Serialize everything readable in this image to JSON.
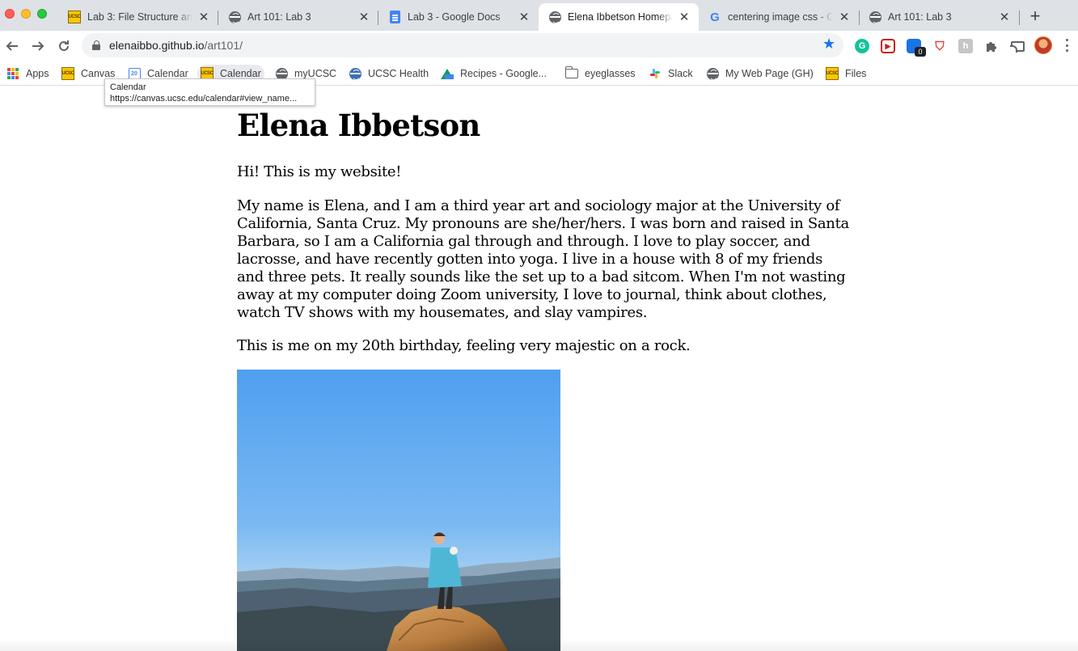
{
  "browser": {
    "tabs": [
      {
        "title": "Lab 3: File Structure and",
        "icon": "ucsc-icon",
        "active": false
      },
      {
        "title": "Art 101: Lab 3",
        "icon": "globe-icon",
        "active": false
      },
      {
        "title": "Lab 3 - Google Docs",
        "icon": "google-docs-icon",
        "active": false
      },
      {
        "title": "Elena Ibbetson Homepage",
        "icon": "globe-icon",
        "active": true
      },
      {
        "title": "centering image css - Goo",
        "icon": "google-icon",
        "active": false
      },
      {
        "title": "Art 101: Lab 3",
        "icon": "globe-icon",
        "active": false
      }
    ],
    "close_glyph": "✕",
    "new_tab_glyph": "+",
    "address": {
      "host": "elenaibbo.github.io",
      "path": "/art101/"
    },
    "extensions": {
      "grammarly": "G",
      "redbox": "▶",
      "bot_badge": "0",
      "grayh": "h"
    },
    "bookmarks": [
      {
        "label": "Apps",
        "icon": "apps-grid-icon"
      },
      {
        "label": "Canvas",
        "icon": "ucsc-icon"
      },
      {
        "label": "Calendar",
        "icon": "google-calendar-icon"
      },
      {
        "label": "Calendar",
        "icon": "ucsc-icon"
      },
      {
        "label": "myUCSC",
        "icon": "globe-icon"
      },
      {
        "label": "UCSC Health",
        "icon": "globe-icon"
      },
      {
        "label": "Recipes - Google...",
        "icon": "google-drive-icon"
      },
      {
        "label": "eyeglasses",
        "icon": "folder-icon"
      },
      {
        "label": "Slack",
        "icon": "slack-icon"
      },
      {
        "label": "My Web Page (GH)",
        "icon": "globe-icon"
      },
      {
        "label": "Files",
        "icon": "ucsc-icon"
      }
    ],
    "tooltip": {
      "title": "Calendar",
      "url": "https://canvas.ucsc.edu/calendar#view_name..."
    },
    "ucsc_favicon_text": "UCSC",
    "calendar_favicon_text": "20"
  },
  "page": {
    "heading": "Elena Ibbetson",
    "intro": "Hi! This is my website!",
    "bio": "My name is Elena, and I am a third year art and sociology major at the University of California, Santa Cruz. My pronouns are she/her/hers. I was born and raised in Santa Barbara, so I am a California gal through and through. I love to play soccer, and lacrosse, and have recently gotten into yoga. I live in a house with 8 of my friends and three pets. It really sounds like the set up to a bad sitcom. When I'm not wasting away at my computer doing Zoom university, I love to journal, think about clothes, watch TV shows with my housemates, and slay vampires.",
    "photo_caption": "This is me on my 20th birthday, feeling very majestic on a rock."
  },
  "colors": {
    "tabstrip": "#dee1e6",
    "accent": "#1a73e8",
    "text": "#000000"
  }
}
